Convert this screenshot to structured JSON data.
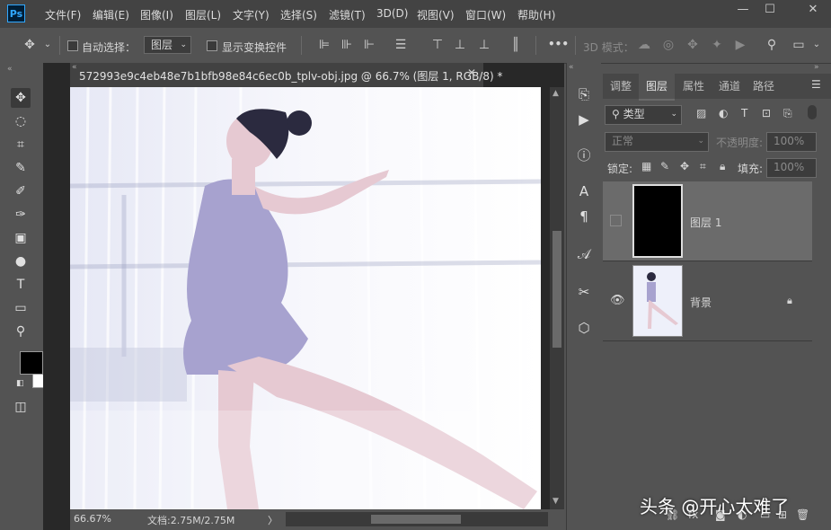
{
  "app": {
    "logo": "Ps"
  },
  "menu": [
    "文件(F)",
    "编辑(E)",
    "图像(I)",
    "图层(L)",
    "文字(Y)",
    "选择(S)",
    "滤镜(T)",
    "3D(D)",
    "视图(V)",
    "窗口(W)",
    "帮助(H)"
  ],
  "window_controls": {
    "minimize": "—",
    "maximize": "☐",
    "close": "✕"
  },
  "options": {
    "auto_select_label": "自动选择：",
    "auto_select_value": "图层",
    "show_transform_label": "显示变换控件",
    "mode_3d_label": "3D 模式：",
    "more": "•••"
  },
  "document": {
    "tab_title": "572993e9c4eb48e7b1bfb98e84c6ec0b_tplv-obj.jpg @ 66.7% (图层 1, RGB/8) *",
    "close": "✕",
    "zoom": "66.67%",
    "doc_size": "文档:2.75M/2.75M",
    "arrow": "〉"
  },
  "panel_tabs": [
    "调整",
    "图层",
    "属性",
    "通道",
    "路径"
  ],
  "layers_panel": {
    "filter_label": "类型",
    "blend_mode": "正常",
    "opacity_label": "不透明度:",
    "opacity_value": "100%",
    "lock_label": "锁定:",
    "fill_label": "填充:",
    "fill_value": "100%",
    "layers": [
      {
        "name": "图层 1",
        "visible": false,
        "locked": false
      },
      {
        "name": "背景",
        "visible": true,
        "locked": true
      }
    ]
  },
  "watermark": "头条 @开心太难了",
  "colors": {
    "foreground": "#000000",
    "background": "#ffffff",
    "accent": "#31a8ff"
  }
}
